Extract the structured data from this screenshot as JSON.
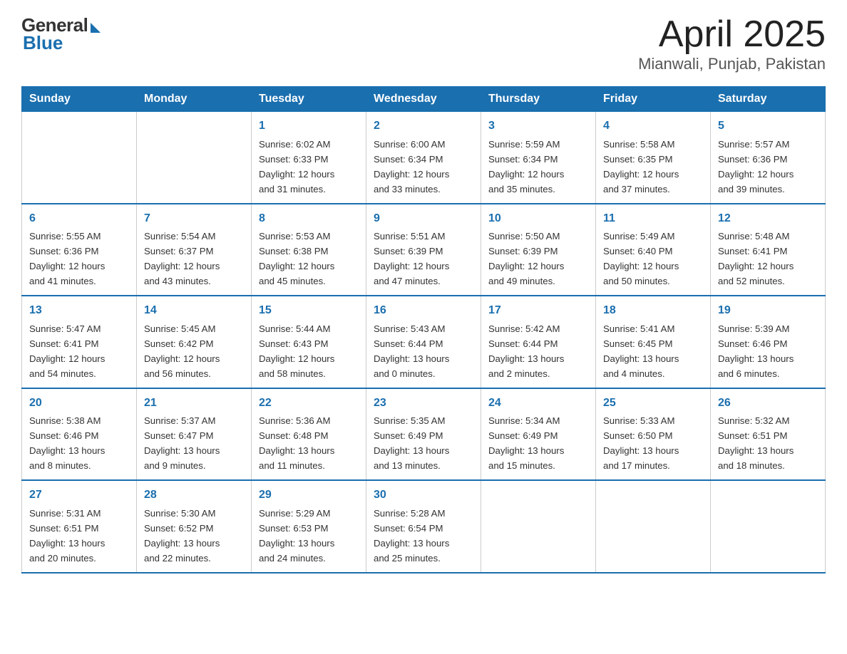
{
  "logo": {
    "general": "General",
    "blue": "Blue"
  },
  "title": "April 2025",
  "subtitle": "Mianwali, Punjab, Pakistan",
  "weekdays": [
    "Sunday",
    "Monday",
    "Tuesday",
    "Wednesday",
    "Thursday",
    "Friday",
    "Saturday"
  ],
  "weeks": [
    [
      {
        "day": "",
        "info": ""
      },
      {
        "day": "",
        "info": ""
      },
      {
        "day": "1",
        "info": "Sunrise: 6:02 AM\nSunset: 6:33 PM\nDaylight: 12 hours\nand 31 minutes."
      },
      {
        "day": "2",
        "info": "Sunrise: 6:00 AM\nSunset: 6:34 PM\nDaylight: 12 hours\nand 33 minutes."
      },
      {
        "day": "3",
        "info": "Sunrise: 5:59 AM\nSunset: 6:34 PM\nDaylight: 12 hours\nand 35 minutes."
      },
      {
        "day": "4",
        "info": "Sunrise: 5:58 AM\nSunset: 6:35 PM\nDaylight: 12 hours\nand 37 minutes."
      },
      {
        "day": "5",
        "info": "Sunrise: 5:57 AM\nSunset: 6:36 PM\nDaylight: 12 hours\nand 39 minutes."
      }
    ],
    [
      {
        "day": "6",
        "info": "Sunrise: 5:55 AM\nSunset: 6:36 PM\nDaylight: 12 hours\nand 41 minutes."
      },
      {
        "day": "7",
        "info": "Sunrise: 5:54 AM\nSunset: 6:37 PM\nDaylight: 12 hours\nand 43 minutes."
      },
      {
        "day": "8",
        "info": "Sunrise: 5:53 AM\nSunset: 6:38 PM\nDaylight: 12 hours\nand 45 minutes."
      },
      {
        "day": "9",
        "info": "Sunrise: 5:51 AM\nSunset: 6:39 PM\nDaylight: 12 hours\nand 47 minutes."
      },
      {
        "day": "10",
        "info": "Sunrise: 5:50 AM\nSunset: 6:39 PM\nDaylight: 12 hours\nand 49 minutes."
      },
      {
        "day": "11",
        "info": "Sunrise: 5:49 AM\nSunset: 6:40 PM\nDaylight: 12 hours\nand 50 minutes."
      },
      {
        "day": "12",
        "info": "Sunrise: 5:48 AM\nSunset: 6:41 PM\nDaylight: 12 hours\nand 52 minutes."
      }
    ],
    [
      {
        "day": "13",
        "info": "Sunrise: 5:47 AM\nSunset: 6:41 PM\nDaylight: 12 hours\nand 54 minutes."
      },
      {
        "day": "14",
        "info": "Sunrise: 5:45 AM\nSunset: 6:42 PM\nDaylight: 12 hours\nand 56 minutes."
      },
      {
        "day": "15",
        "info": "Sunrise: 5:44 AM\nSunset: 6:43 PM\nDaylight: 12 hours\nand 58 minutes."
      },
      {
        "day": "16",
        "info": "Sunrise: 5:43 AM\nSunset: 6:44 PM\nDaylight: 13 hours\nand 0 minutes."
      },
      {
        "day": "17",
        "info": "Sunrise: 5:42 AM\nSunset: 6:44 PM\nDaylight: 13 hours\nand 2 minutes."
      },
      {
        "day": "18",
        "info": "Sunrise: 5:41 AM\nSunset: 6:45 PM\nDaylight: 13 hours\nand 4 minutes."
      },
      {
        "day": "19",
        "info": "Sunrise: 5:39 AM\nSunset: 6:46 PM\nDaylight: 13 hours\nand 6 minutes."
      }
    ],
    [
      {
        "day": "20",
        "info": "Sunrise: 5:38 AM\nSunset: 6:46 PM\nDaylight: 13 hours\nand 8 minutes."
      },
      {
        "day": "21",
        "info": "Sunrise: 5:37 AM\nSunset: 6:47 PM\nDaylight: 13 hours\nand 9 minutes."
      },
      {
        "day": "22",
        "info": "Sunrise: 5:36 AM\nSunset: 6:48 PM\nDaylight: 13 hours\nand 11 minutes."
      },
      {
        "day": "23",
        "info": "Sunrise: 5:35 AM\nSunset: 6:49 PM\nDaylight: 13 hours\nand 13 minutes."
      },
      {
        "day": "24",
        "info": "Sunrise: 5:34 AM\nSunset: 6:49 PM\nDaylight: 13 hours\nand 15 minutes."
      },
      {
        "day": "25",
        "info": "Sunrise: 5:33 AM\nSunset: 6:50 PM\nDaylight: 13 hours\nand 17 minutes."
      },
      {
        "day": "26",
        "info": "Sunrise: 5:32 AM\nSunset: 6:51 PM\nDaylight: 13 hours\nand 18 minutes."
      }
    ],
    [
      {
        "day": "27",
        "info": "Sunrise: 5:31 AM\nSunset: 6:51 PM\nDaylight: 13 hours\nand 20 minutes."
      },
      {
        "day": "28",
        "info": "Sunrise: 5:30 AM\nSunset: 6:52 PM\nDaylight: 13 hours\nand 22 minutes."
      },
      {
        "day": "29",
        "info": "Sunrise: 5:29 AM\nSunset: 6:53 PM\nDaylight: 13 hours\nand 24 minutes."
      },
      {
        "day": "30",
        "info": "Sunrise: 5:28 AM\nSunset: 6:54 PM\nDaylight: 13 hours\nand 25 minutes."
      },
      {
        "day": "",
        "info": ""
      },
      {
        "day": "",
        "info": ""
      },
      {
        "day": "",
        "info": ""
      }
    ]
  ]
}
